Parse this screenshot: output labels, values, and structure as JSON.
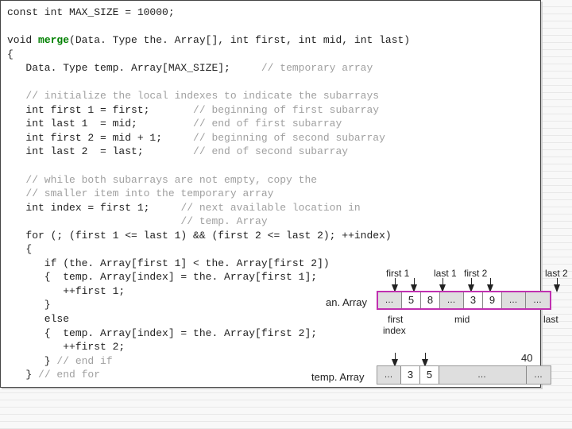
{
  "code": {
    "l1": "const int MAX_SIZE = 10000;",
    "l2": "",
    "l3a": "void ",
    "l3b": "merge",
    "l3c": "(Data. Type the. Array[], int first, int mid, int last)",
    "l4": "{",
    "l5a": "   Data. Type temp. Array[MAX_SIZE];     ",
    "l5b": "// temporary array",
    "l6": "",
    "l7": "   // initialize the local indexes to indicate the subarrays",
    "l8a": "   int first 1 = first;       ",
    "l8b": "// beginning of first subarray",
    "l9a": "   int last 1  = mid;         ",
    "l9b": "// end of first subarray",
    "l10a": "   int first 2 = mid + 1;     ",
    "l10b": "// beginning of second subarray",
    "l11a": "   int last 2  = last;        ",
    "l11b": "// end of second subarray",
    "l12": "",
    "l13": "   // while both subarrays are not empty, copy the",
    "l14": "   // smaller item into the temporary array",
    "l15a": "   int index = first 1;     ",
    "l15b": "// next available location in",
    "l16": "                            // temp. Array",
    "l17": "   for (; (first 1 <= last 1) && (first 2 <= last 2); ++index)",
    "l18": "   {",
    "l19": "      if (the. Array[first 1] < the. Array[first 2])",
    "l20": "      {  temp. Array[index] = the. Array[first 1];",
    "l21": "         ++first 1;",
    "l22": "      }",
    "l23": "      else",
    "l24": "      {  temp. Array[index] = the. Array[first 2];",
    "l25": "         ++first 2;",
    "l26a": "      } ",
    "l26b": "// end if",
    "l27a": "   } ",
    "l27b": "// end for"
  },
  "diagram": {
    "labels": {
      "first1": "first 1",
      "last1": "last 1",
      "first2": "first 2",
      "last2": "last 2",
      "first": "first",
      "index": "index",
      "mid": "mid",
      "last": "last",
      "anArray": "an. Array",
      "tempArray": "temp. Array"
    },
    "anArray": {
      "c0": "…",
      "c1": "5",
      "c2": "8",
      "c3": "…",
      "c4": "3",
      "c5": "9",
      "c6": "…",
      "c7": "…"
    },
    "tempArray": {
      "c0": "…",
      "c1": "3",
      "c2": "5",
      "c3": "…",
      "c4": "…"
    },
    "page": "40"
  }
}
